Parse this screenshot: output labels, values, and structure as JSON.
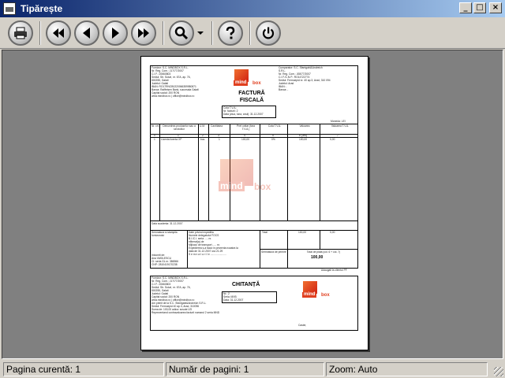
{
  "window": {
    "title": "Tipărește"
  },
  "toolbar": {
    "buttons": [
      {
        "name": "print-button",
        "icon": "printer-icon"
      },
      {
        "name": "first-page-button",
        "icon": "double-left-arrow-icon"
      },
      {
        "name": "prev-page-button",
        "icon": "left-arrow-icon"
      },
      {
        "name": "next-page-button",
        "icon": "right-arrow-icon"
      },
      {
        "name": "last-page-button",
        "icon": "double-right-arrow-icon"
      },
      {
        "name": "zoom-button",
        "icon": "magnifier-icon"
      },
      {
        "name": "help-button",
        "icon": "question-icon"
      },
      {
        "name": "close-preview-button",
        "icon": "power-icon"
      }
    ]
  },
  "invoice": {
    "seller_lines": [
      "Furnizor: S.C. MINDBOX S.R.L.",
      "Nr. Reg. Com.: J17/77/2007",
      "C.I.F.: 20660803",
      "Sediul: Str. Soiuri, nr. 67A, ap. 76,",
      "800255, Galati",
      "Judetul: Galati",
      "IBAN: RO17RNCB0220066359980871",
      "Banca: Raiffeisen Bank, sucursala Galati",
      "Capital social: 200 RON",
      "www.mindbox.ro | office@mindbox.ro"
    ],
    "buyer_lines": [
      "Cumparator: S.C. Sfantgabi&Andreich",
      "S.R.L.",
      "Nr. Reg. Com.: J08/77/2007",
      "C.I.F./C.N.P.: RO14722774",
      "Sediul: Fermoepid nr. 40 ap.3, Arad, 310 094",
      "Judetul: Arad",
      "IBAN: -",
      "Banca: -"
    ],
    "logo": {
      "left": "mind",
      "right": "box"
    },
    "title1": "FACTURĂ",
    "title2": "FISCALĂ",
    "meta_lines": [
      "Cota T.V.A.:",
      "Nr. facturii: 2",
      "Data (ziua, luna, anul): 31.12.2007"
    ],
    "currency": "Moneda: LEI",
    "col_headers": [
      "Nr. crt.",
      "Denumirea produselor sau a serviciilor",
      "U.M.",
      "Cantitatea",
      "Pret unitar (fara T.V.A.)",
      "Cota T.V.A.",
      "Valoarea",
      "Valoarea T.V.A."
    ],
    "col_subheaders": [
      "0",
      "1",
      "2",
      "3",
      "4",
      "5",
      "6 (3x4)",
      "7"
    ],
    "row": [
      "1",
      "Licenta licenta XP",
      "buc.",
      "1",
      "100,00",
      "0%",
      "100,00",
      "0,00"
    ],
    "due_date": "Data scadenta: 31.12.2007",
    "stamp_label": "Semnatura si stampila furnizorului",
    "delegate_lines": [
      "Date privind expeditia",
      "Numele delegatului FOCS",
      "B.I./C.I. seria ..... nr.",
      "eliberat(a) de",
      "Mijlocul de transport ..... nr.",
      "Expedierea s-a facut in prezenta noastra la",
      "data de 31.12.2007 ora 21:29",
      "S e m n a t u r i l e ......................"
    ],
    "signer_lines": [
      "Intocmit de:",
      "Ana VASILESCU",
      "CI: seria GL nr. 386966",
      "CNP: 2810419170238"
    ],
    "total_label": "Total",
    "total_value": "100,00",
    "total_vat": "0,00",
    "receipt_label": "Semnatura de primire",
    "grand_label": "Total de plata (col. 6 + col. 7)",
    "grand_value": "100,00",
    "footer_note": "Adaugati la clientul PF"
  },
  "receipt": {
    "seller_lines": [
      "Furnizor: S.C. MINDBOX S.R.L.",
      "Nr. Reg. Com.: J17/77/2007",
      "C.I.F.: 20660803",
      "Sediul: Str. Soiuri, nr. 67A, ap. 76,",
      "800255, Galati",
      "Judetul: Galati",
      "Capital social: 200 RON",
      "www.mindbox.ro | office@mindbox.ro"
    ],
    "body_lines": [
      "Am primit de la S.C. Sfantgabi&Andreich S.R.L.",
      "Sediul: Fermoepid 40 ap.3, Arad, 310096",
      "Suma de: 100,00 adica: sosute LEI",
      "Reprezentand contravaloarea facturii numarul 2 seria MND"
    ],
    "title": "CHITANȚĂ",
    "meta_lines": [
      "Nr.: 2",
      "Seria: MXB",
      "Data: 31.12.2007"
    ],
    "cashier": "Casier,"
  },
  "status": {
    "current_page": "Pagina curentă: 1",
    "total_pages": "Număr de pagini: 1",
    "zoom": "Zoom: Auto"
  }
}
